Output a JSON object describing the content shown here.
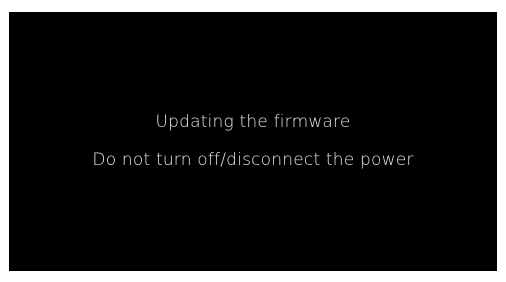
{
  "screen": {
    "background": "#000000",
    "text_color": "#e6e6e6",
    "message_line_1": "Updating the firmware",
    "message_line_2": "Do not turn off/disconnect the power"
  }
}
